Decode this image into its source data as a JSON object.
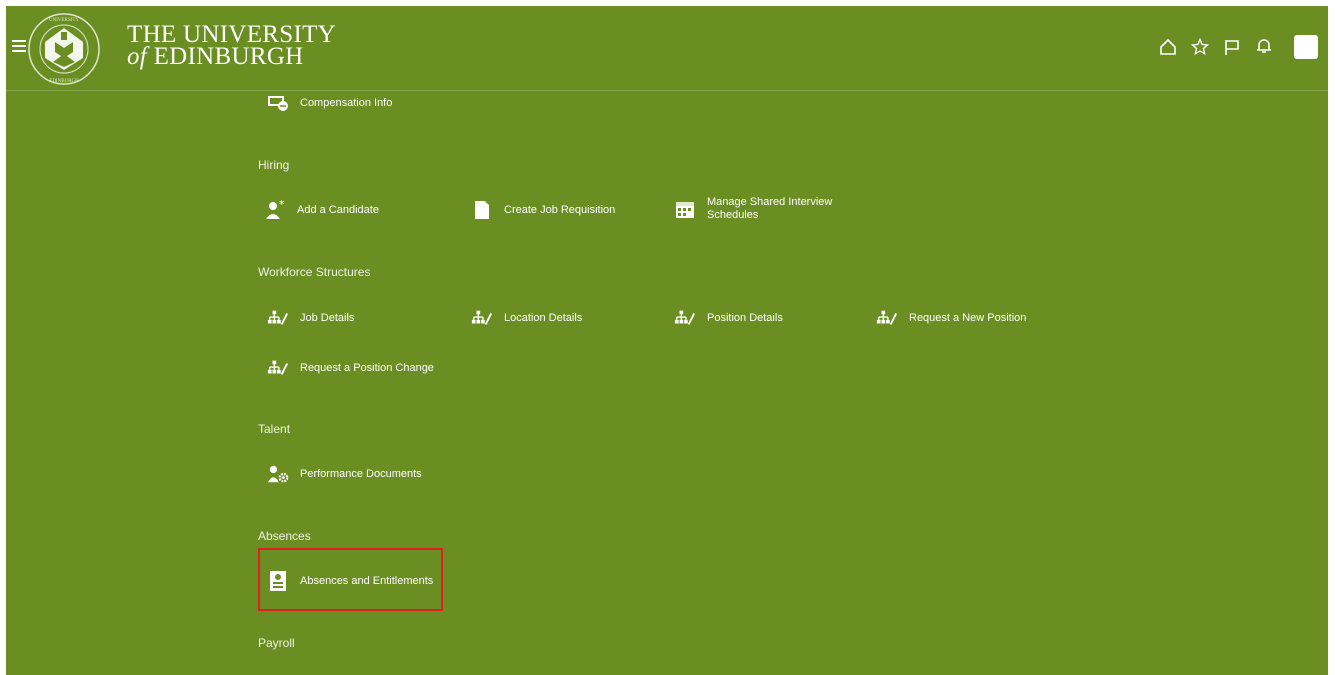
{
  "header": {
    "logo_line1": "THE UNIVERSITY",
    "logo_line2_of": "of",
    "logo_line2_rest": "EDINBURGH",
    "icons": [
      "home-icon",
      "star-icon",
      "flag-icon",
      "bell-icon"
    ]
  },
  "sections": {
    "hiring": "Hiring",
    "workforce": "Workforce Structures",
    "talent": "Talent",
    "absences": "Absences",
    "payroll": "Payroll"
  },
  "tiles": {
    "compensation_info": "Compensation Info",
    "add_candidate": "Add a Candidate",
    "create_job_requisition": "Create Job Requisition",
    "manage_interview_line1": "Manage Shared Interview",
    "manage_interview_line2": "Schedules",
    "job_details": "Job Details",
    "location_details": "Location Details",
    "position_details": "Position Details",
    "request_new_position": "Request a New Position",
    "request_position_change": "Request a Position Change",
    "performance_documents": "Performance Documents",
    "absences_entitlements": "Absences and Entitlements"
  },
  "colors": {
    "background": "#6b8e23",
    "highlight": "#e02020"
  }
}
